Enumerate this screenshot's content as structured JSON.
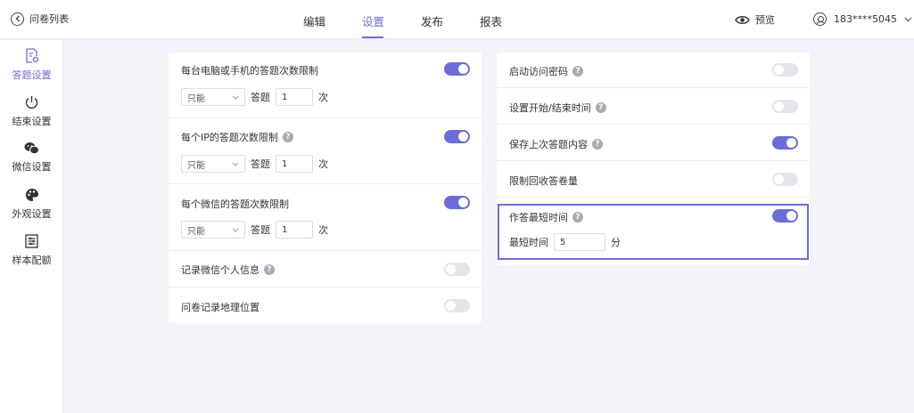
{
  "header": {
    "back_label": "问卷列表",
    "tabs": [
      {
        "label": "编辑",
        "active": false
      },
      {
        "label": "设置",
        "active": true
      },
      {
        "label": "发布",
        "active": false
      },
      {
        "label": "报表",
        "active": false
      }
    ],
    "preview_label": "预览",
    "user_label": "183****5045"
  },
  "sidebar": {
    "items": [
      {
        "label": "答题设置",
        "icon": "file-settings-icon",
        "active": true
      },
      {
        "label": "结束设置",
        "icon": "power-icon",
        "active": false
      },
      {
        "label": "微信设置",
        "icon": "wechat-icon",
        "active": false
      },
      {
        "label": "外观设置",
        "icon": "palette-icon",
        "active": false
      },
      {
        "label": "样本配额",
        "icon": "quota-icon",
        "active": false
      }
    ]
  },
  "left_card": {
    "limits": [
      {
        "title": "每台电脑或手机的答题次数限制",
        "help": false,
        "toggle": true,
        "select_value": "只能",
        "word_answer": "答题",
        "count": "1",
        "unit": "次"
      },
      {
        "title": "每个IP的答题次数限制",
        "help": true,
        "toggle": true,
        "select_value": "只能",
        "word_answer": "答题",
        "count": "1",
        "unit": "次"
      },
      {
        "title": "每个微信的答题次数限制",
        "help": false,
        "toggle": true,
        "select_value": "只能",
        "word_answer": "答题",
        "count": "1",
        "unit": "次"
      }
    ],
    "simple": [
      {
        "title": "记录微信个人信息",
        "help": true,
        "toggle": false
      },
      {
        "title": "问卷记录地理位置",
        "help": false,
        "toggle": false
      }
    ]
  },
  "right_card": {
    "rows": [
      {
        "title": "启动访问密码",
        "help": true,
        "toggle": false
      },
      {
        "title": "设置开始/结束时间",
        "help": true,
        "toggle": false
      },
      {
        "title": "保存上次答题内容",
        "help": true,
        "toggle": true
      },
      {
        "title": "限制回收答卷量",
        "help": false,
        "toggle": false
      }
    ],
    "min_time": {
      "title": "作答最短时间",
      "help": true,
      "toggle": true,
      "field_label": "最短时间",
      "value": "5",
      "unit": "分"
    }
  },
  "colors": {
    "accent": "#6a6dd8",
    "toggle_off": "#e4e5ea",
    "background": "#f3f4f7"
  }
}
